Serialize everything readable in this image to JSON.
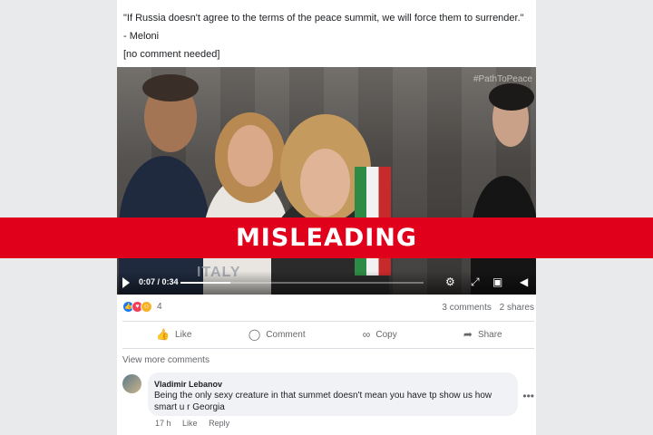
{
  "post": {
    "quote": "\"If Russia doesn't agree to the terms of the peace summit, we will force them to surrender.\"",
    "attribution": "- Meloni",
    "note": "[no comment needed]"
  },
  "video": {
    "hashtag": "#PathToPeace",
    "caption": "ITALY",
    "time": "0:07 / 0:34",
    "progress": 0.206,
    "icons": [
      "play-icon",
      "settings-icon",
      "fullscreen-icon",
      "pip-icon",
      "volume-icon"
    ]
  },
  "banner": {
    "label": "MISLEADING",
    "color": "#e0001b"
  },
  "reactions": {
    "count": "4",
    "icons": [
      "like-icon",
      "love-icon",
      "haha-icon"
    ]
  },
  "stats": {
    "comments": "3 comments",
    "shares": "2 shares"
  },
  "actions": {
    "like": "Like",
    "comment": "Comment",
    "copy": "Copy",
    "share": "Share"
  },
  "comments_section": {
    "view_more": "View more comments",
    "comment": {
      "author": "Vladimir Lebanov",
      "text": "Being the only sexy creature in that summet doesn't mean you have tp show us how smart u r Georgia",
      "age": "17 h",
      "like": "Like",
      "reply": "Reply"
    }
  }
}
